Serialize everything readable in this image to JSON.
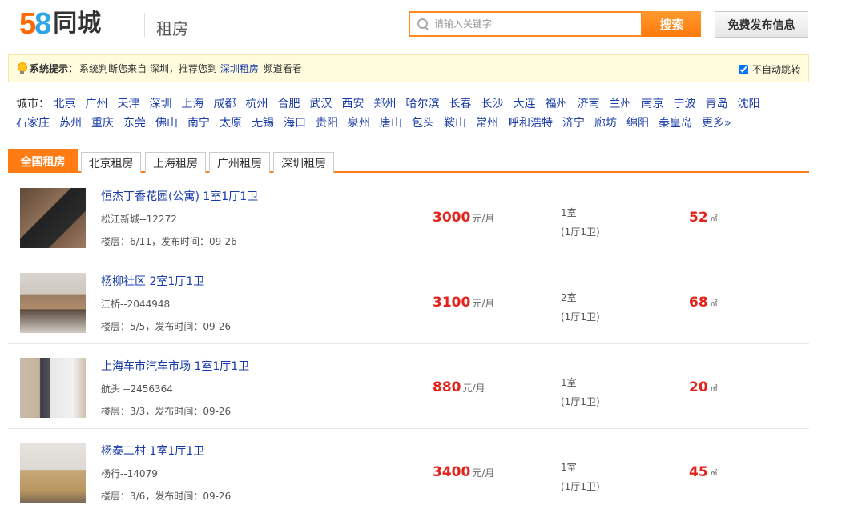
{
  "header": {
    "logo_number": "58",
    "logo_text": "同城",
    "page_title": "租房",
    "search_placeholder": "请输入关键字",
    "search_button": "搜索",
    "post_button": "免费发布信息"
  },
  "notice": {
    "label": "系统提示：",
    "text_before": "系统判断您来自 深圳，推荐您到",
    "link": "深圳租房",
    "text_after": "频道看看",
    "no_jump_label": "不自动跳转",
    "no_jump_checked": true
  },
  "cities": {
    "label": "城市：",
    "list": [
      "北京",
      "广州",
      "天津",
      "深圳",
      "上海",
      "成都",
      "杭州",
      "合肥",
      "武汉",
      "西安",
      "郑州",
      "哈尔滨",
      "长春",
      "长沙",
      "大连",
      "福州",
      "济南",
      "兰州",
      "南京",
      "宁波",
      "青岛",
      "沈阳",
      "石家庄",
      "苏州",
      "重庆",
      "东莞",
      "佛山",
      "南宁",
      "太原",
      "无锡",
      "海口",
      "贵阳",
      "泉州",
      "唐山",
      "包头",
      "鞍山",
      "常州",
      "呼和浩特",
      "济宁",
      "廊坊",
      "绵阳",
      "秦皇岛",
      "更多»"
    ]
  },
  "tabs": [
    "全国租房",
    "北京租房",
    "上海租房",
    "广州租房",
    "深圳租房"
  ],
  "listings": [
    {
      "title": "恒杰丁香花园(公寓) 1室1厅1卫",
      "location": "松江新城--12272",
      "floor": "楼层：6/11，发布时间：09-26",
      "price": "3000",
      "price_unit": "元/月",
      "rooms": "1室",
      "layout": "(1厅1卫)",
      "area": "52",
      "area_unit": "㎡"
    },
    {
      "title": "杨柳社区 2室1厅1卫",
      "location": "江桥--2044948",
      "floor": "楼层：5/5，发布时间：09-26",
      "price": "3100",
      "price_unit": "元/月",
      "rooms": "2室",
      "layout": "(1厅1卫)",
      "area": "68",
      "area_unit": "㎡"
    },
    {
      "title": "上海车市汽车市场 1室1厅1卫",
      "location": "航头 --2456364",
      "floor": "楼层：3/3，发布时间：09-26",
      "price": "880",
      "price_unit": "元/月",
      "rooms": "1室",
      "layout": "(1厅1卫)",
      "area": "20",
      "area_unit": "㎡"
    },
    {
      "title": "杨泰二村 1室1厅1卫",
      "location": "杨行--14079",
      "floor": "楼层：3/6，发布时间：09-26",
      "price": "3400",
      "price_unit": "元/月",
      "rooms": "1室",
      "layout": "(1厅1卫)",
      "area": "45",
      "area_unit": "㎡"
    }
  ]
}
